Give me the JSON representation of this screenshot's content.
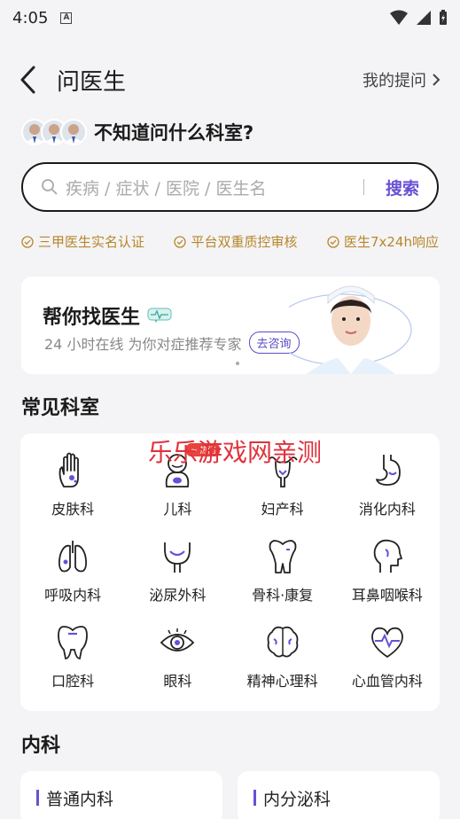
{
  "status": {
    "time": "4:05"
  },
  "header": {
    "title": "问医生",
    "my_questions": "我的提问"
  },
  "ask": {
    "text": "不知道问什么科室?"
  },
  "search": {
    "placeholder": "疾病 / 症状 / 医院 / 医生名",
    "button": "搜索"
  },
  "assurances": [
    "三甲医生实名认证",
    "平台双重质控审核",
    "医生7x24h响应"
  ],
  "banner": {
    "title": "帮你找医生",
    "subtitle": "24 小时在线 为你对症推荐专家",
    "consult": "去咨询"
  },
  "common_depts": {
    "title": "常见科室",
    "hot_badge": "≈ 热门",
    "items": [
      {
        "label": "皮肤科",
        "icon": "hand-icon"
      },
      {
        "label": "儿科",
        "icon": "baby-icon"
      },
      {
        "label": "妇产科",
        "icon": "uterus-icon"
      },
      {
        "label": "消化内科",
        "icon": "stomach-icon"
      },
      {
        "label": "呼吸内科",
        "icon": "lungs-icon"
      },
      {
        "label": "泌尿外科",
        "icon": "bladder-icon"
      },
      {
        "label": "骨科·康复",
        "icon": "bone-icon"
      },
      {
        "label": "耳鼻咽喉科",
        "icon": "head-profile-icon"
      },
      {
        "label": "口腔科",
        "icon": "tooth-icon"
      },
      {
        "label": "眼科",
        "icon": "eye-icon"
      },
      {
        "label": "精神心理科",
        "icon": "brain-icon"
      },
      {
        "label": "心血管内科",
        "icon": "heart-icon"
      }
    ]
  },
  "watermark": "乐乐游戏网亲测",
  "internal": {
    "title": "内科",
    "items": [
      "普通内科",
      "内分泌科"
    ]
  },
  "colors": {
    "accent": "#6a4fd6",
    "assurance": "#b8862a",
    "watermark": "#e0323c"
  }
}
